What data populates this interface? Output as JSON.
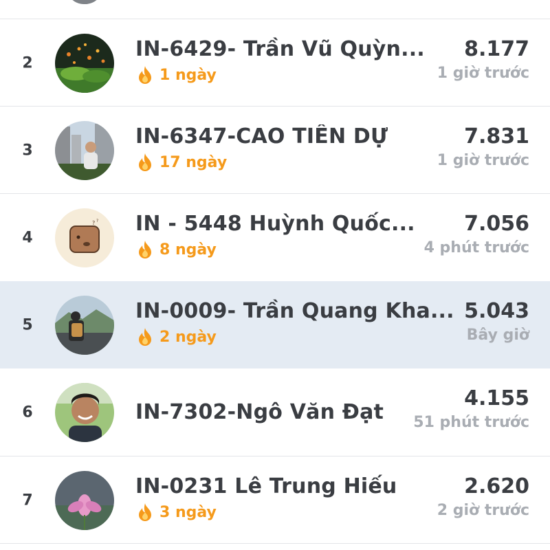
{
  "leaderboard": {
    "rows": [
      {
        "rank": "2",
        "name": "IN-6429- Trần Vũ Quỳn...",
        "streak": "1 ngày",
        "points": "8.177",
        "time": "1 giờ trước",
        "highlight": false
      },
      {
        "rank": "3",
        "name": "IN-6347-CAO TIẾN DỰ",
        "streak": "17 ngày",
        "points": "7.831",
        "time": "1 giờ trước",
        "highlight": false
      },
      {
        "rank": "4",
        "name": "IN - 5448 Huỳnh Quốc...",
        "streak": "8 ngày",
        "points": "7.056",
        "time": "4 phút trước",
        "highlight": false
      },
      {
        "rank": "5",
        "name": "IN-0009- Trần Quang Kha...",
        "streak": "2 ngày",
        "points": "5.043",
        "time": "Bây giờ",
        "highlight": true
      },
      {
        "rank": "6",
        "name": "IN-7302-Ngô Văn Đạt",
        "streak": "",
        "points": "4.155",
        "time": "51 phút trước",
        "highlight": false
      },
      {
        "rank": "7",
        "name": "IN-0231 Lê Trung Hiếu",
        "streak": "3 ngày",
        "points": "2.620",
        "time": "2 giờ trước",
        "highlight": false
      }
    ]
  },
  "icons": {
    "streak": "flame-icon",
    "avatar": "user-avatar"
  },
  "colors": {
    "accent_streak": "#f59a1b",
    "highlight_row": "#e4ebf3",
    "text_primary": "#3a3d42",
    "text_secondary": "#a9adb3"
  }
}
